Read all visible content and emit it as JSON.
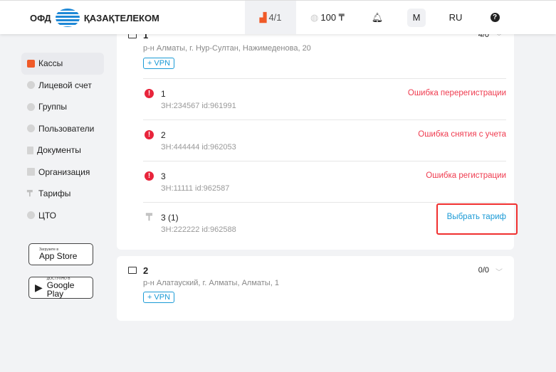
{
  "header": {
    "logo_left": "ОФД",
    "logo_right": "ҚАЗАҚТЕЛЕКОМ",
    "cashboxes": "4/1",
    "balance": "100 ₸",
    "avatar": "M",
    "lang": "RU"
  },
  "sidebar": {
    "items": [
      {
        "label": "Кассы",
        "icon": "cash-register-icon"
      },
      {
        "label": "Лицевой счет",
        "icon": "coins-icon"
      },
      {
        "label": "Группы",
        "icon": "groups-icon"
      },
      {
        "label": "Пользователи",
        "icon": "user-icon"
      },
      {
        "label": "Документы",
        "icon": "document-icon"
      },
      {
        "label": "Организация",
        "icon": "building-icon"
      },
      {
        "label": "Тарифы",
        "icon": "tenge-icon"
      },
      {
        "label": "ЦТО",
        "icon": "wrench-icon"
      }
    ],
    "appstore": {
      "small": "Загрузите в",
      "big": "App Store"
    },
    "googleplay": {
      "small": "ДОСТУПНО В",
      "big": "Google Play"
    }
  },
  "cards": [
    {
      "title": "1",
      "count": "4/0",
      "address": "р-н Алматы, г. Нур-Султан, Нажимеденова, 20",
      "vpn": "+ VPN",
      "rows": [
        {
          "name": "1",
          "sub": "ЗН:234567  id:961991",
          "status": "Ошибка перерегистрации"
        },
        {
          "name": "2",
          "sub": "ЗН:444444  id:962053",
          "status": "Ошибка снятия с учета"
        },
        {
          "name": "3",
          "sub": "ЗН:11111  id:962587",
          "status": "Ошибка регистрации"
        },
        {
          "name": "3 (1)",
          "sub": "ЗН:222222  id:962588",
          "action": "Выбрать тариф"
        }
      ]
    },
    {
      "title": "2",
      "count": "0/0",
      "address": "р-н Алатауский, г. Алматы, Алматы, 1",
      "vpn": "+ VPN"
    }
  ],
  "colors": {
    "accent": "#1a9ad6",
    "error": "#ef3b4f",
    "highlight": "#f0302f"
  }
}
